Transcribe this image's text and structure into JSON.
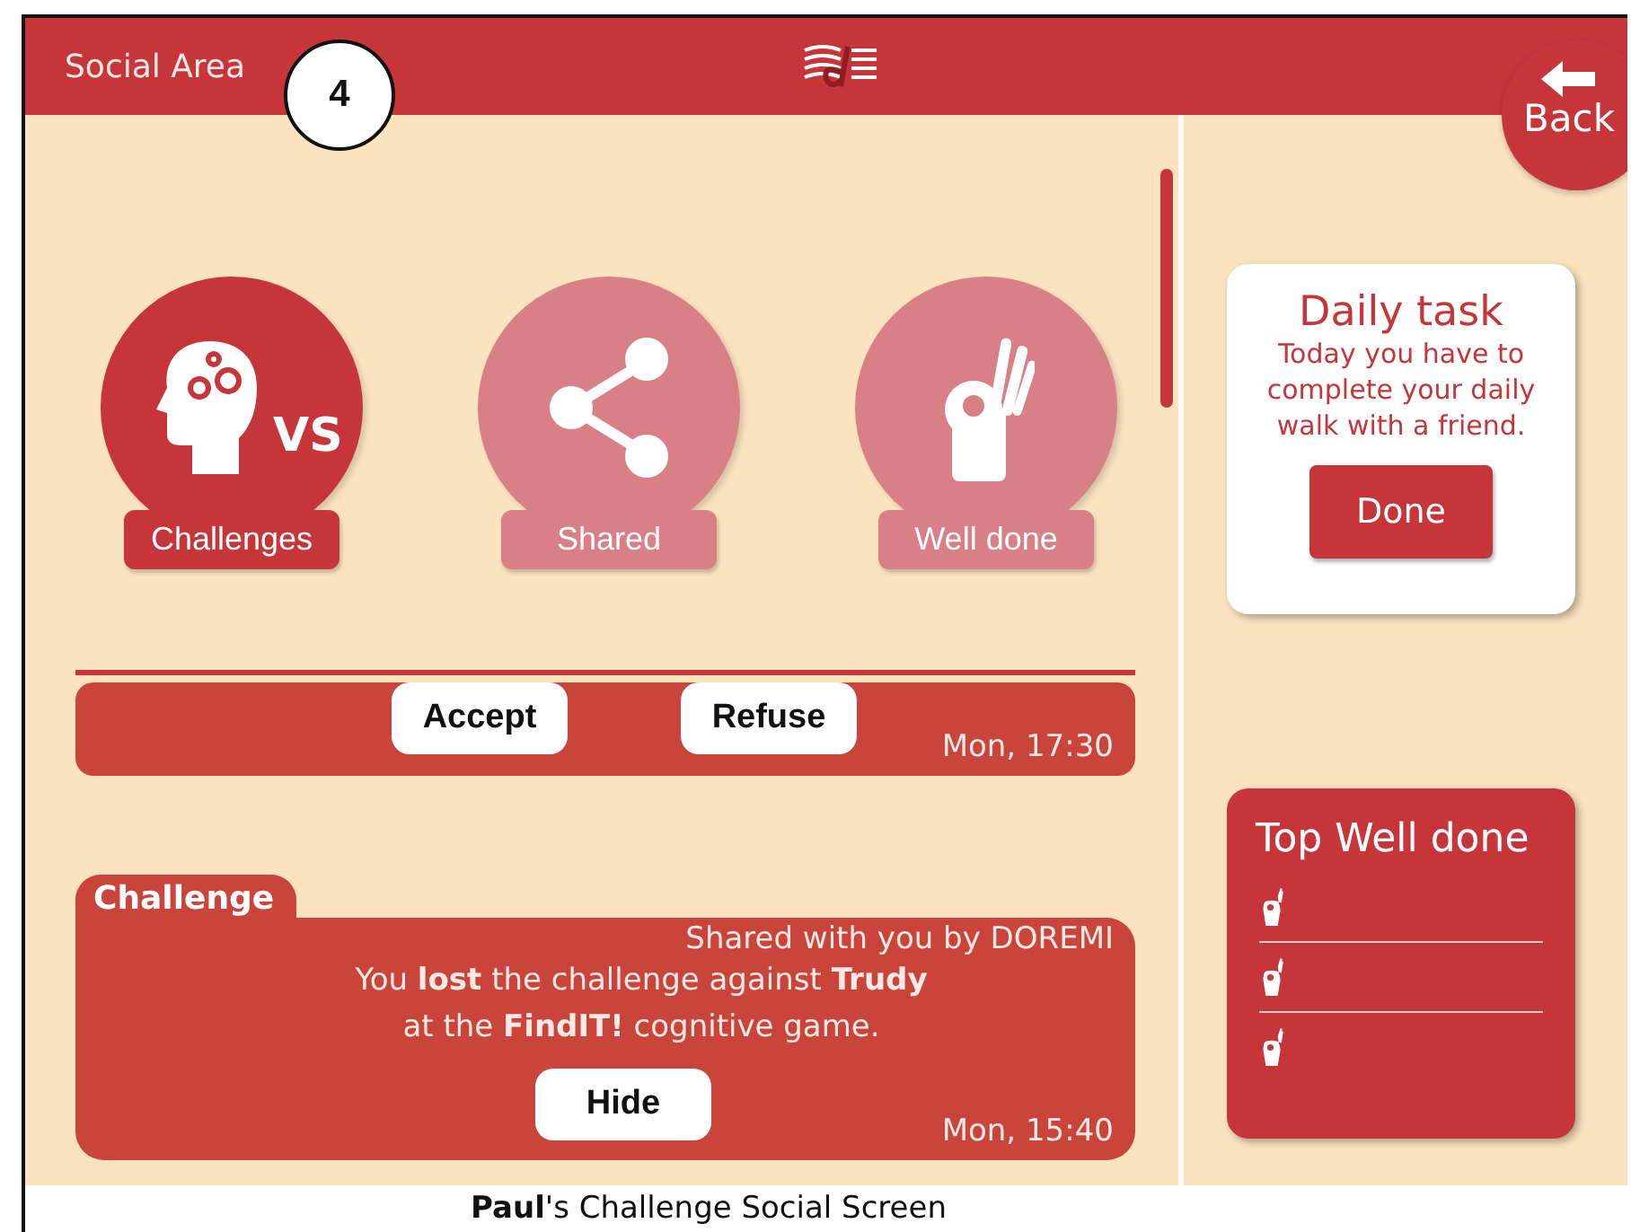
{
  "header": {
    "title": "Social Area",
    "step_badge": "4",
    "back_label": "Back"
  },
  "tabs": [
    {
      "kind": "challenges",
      "label": "Challenges",
      "icon_text": "VS",
      "selected": true
    },
    {
      "kind": "shared",
      "label": "Shared",
      "selected": false
    },
    {
      "kind": "well_done",
      "label": "Well done",
      "selected": false
    }
  ],
  "messages": [
    {
      "kind": "request",
      "actions": [
        "Accept",
        "Refuse"
      ],
      "time": "Mon, 17:30"
    },
    {
      "kind": "challenge",
      "tag": "Challenge",
      "shared_by": "Shared with you by DOREMI",
      "lines": [
        "You **lost** the challenge against **Trudy**",
        "at the **FindIT!** cognitive game."
      ],
      "actions": [
        "Hide"
      ],
      "time": "Mon, 15:40"
    }
  ],
  "daily_task": {
    "title": "Daily task",
    "text": "Today you have to complete your daily walk with a friend.",
    "button": "Done"
  },
  "top_well_done": {
    "title": "Top Well done"
  },
  "caption": "**Paul**'s Challenge Social Screen"
}
